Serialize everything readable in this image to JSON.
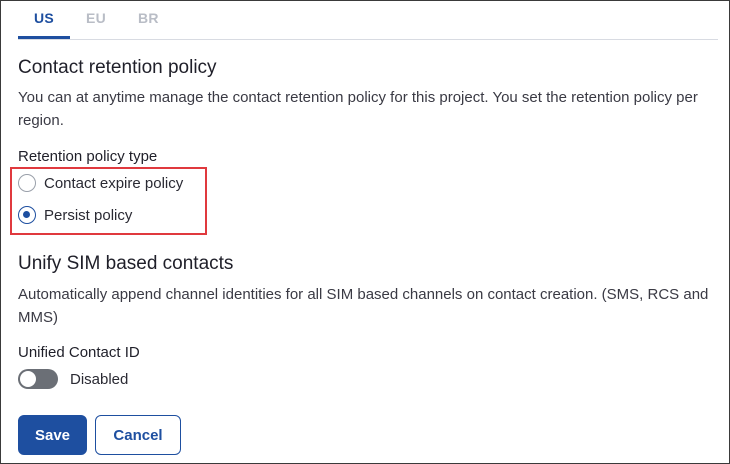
{
  "tabs": [
    {
      "label": "US",
      "active": true
    },
    {
      "label": "EU",
      "active": false
    },
    {
      "label": "BR",
      "active": false
    }
  ],
  "retention": {
    "title": "Contact retention policy",
    "description": "You can at anytime manage the contact retention policy for this project. You set the retention policy per region.",
    "type_label": "Retention policy type",
    "options": [
      {
        "label": "Contact expire policy",
        "checked": false
      },
      {
        "label": "Persist policy",
        "checked": true
      }
    ]
  },
  "unify": {
    "title": "Unify SIM based contacts",
    "description": "Automatically append channel identities for all SIM based channels on contact creation. (SMS, RCS and MMS)",
    "field_label": "Unified Contact ID",
    "toggle_state": "Disabled",
    "toggle_on": false
  },
  "actions": {
    "save_label": "Save",
    "cancel_label": "Cancel"
  },
  "colors": {
    "accent": "#1e4fa0",
    "highlight": "#e0393e",
    "toggle_off": "#6b6f76"
  }
}
